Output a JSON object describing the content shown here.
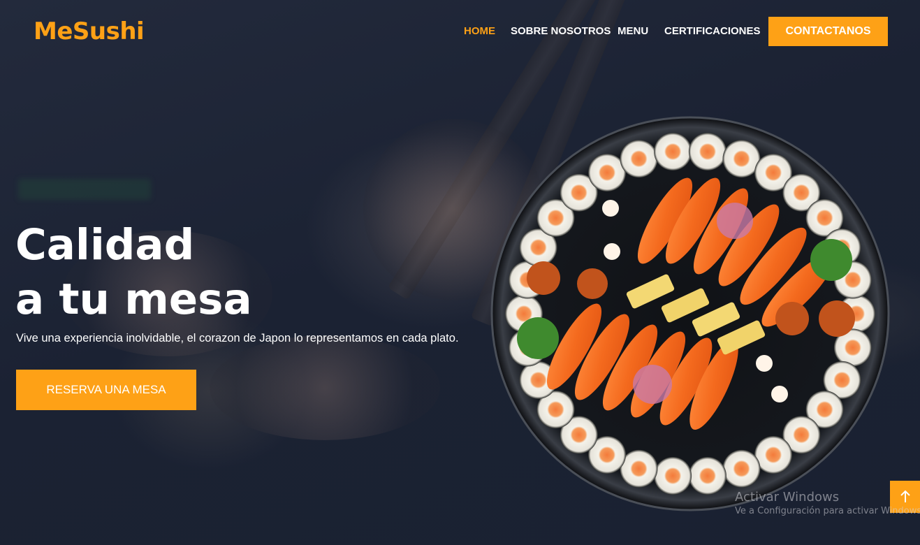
{
  "brand": {
    "name": "MeSushi",
    "accent": "#fea116"
  },
  "nav": {
    "items": [
      {
        "label": "HOME",
        "active": true
      },
      {
        "label": "SOBRE NOSOTROS",
        "active": false
      },
      {
        "label": "MENU",
        "active": false
      },
      {
        "label": "CERTIFICACIONES",
        "active": false
      }
    ],
    "cta_label": "CONTACTANOS"
  },
  "hero": {
    "title_line1": "Calidad",
    "title_line2": "a tu mesa",
    "subtitle": "Vive una experiencia inolvidable, el corazon de Japon lo representamos en cada plato.",
    "reserve_label": "RESERVA UNA MESA",
    "image": "sushi-platter"
  },
  "back_to_top": {
    "icon": "arrow-up-icon"
  },
  "windows_watermark": {
    "title": "Activar Windows",
    "subtitle": "Ve a Configuración para activar Windows."
  }
}
